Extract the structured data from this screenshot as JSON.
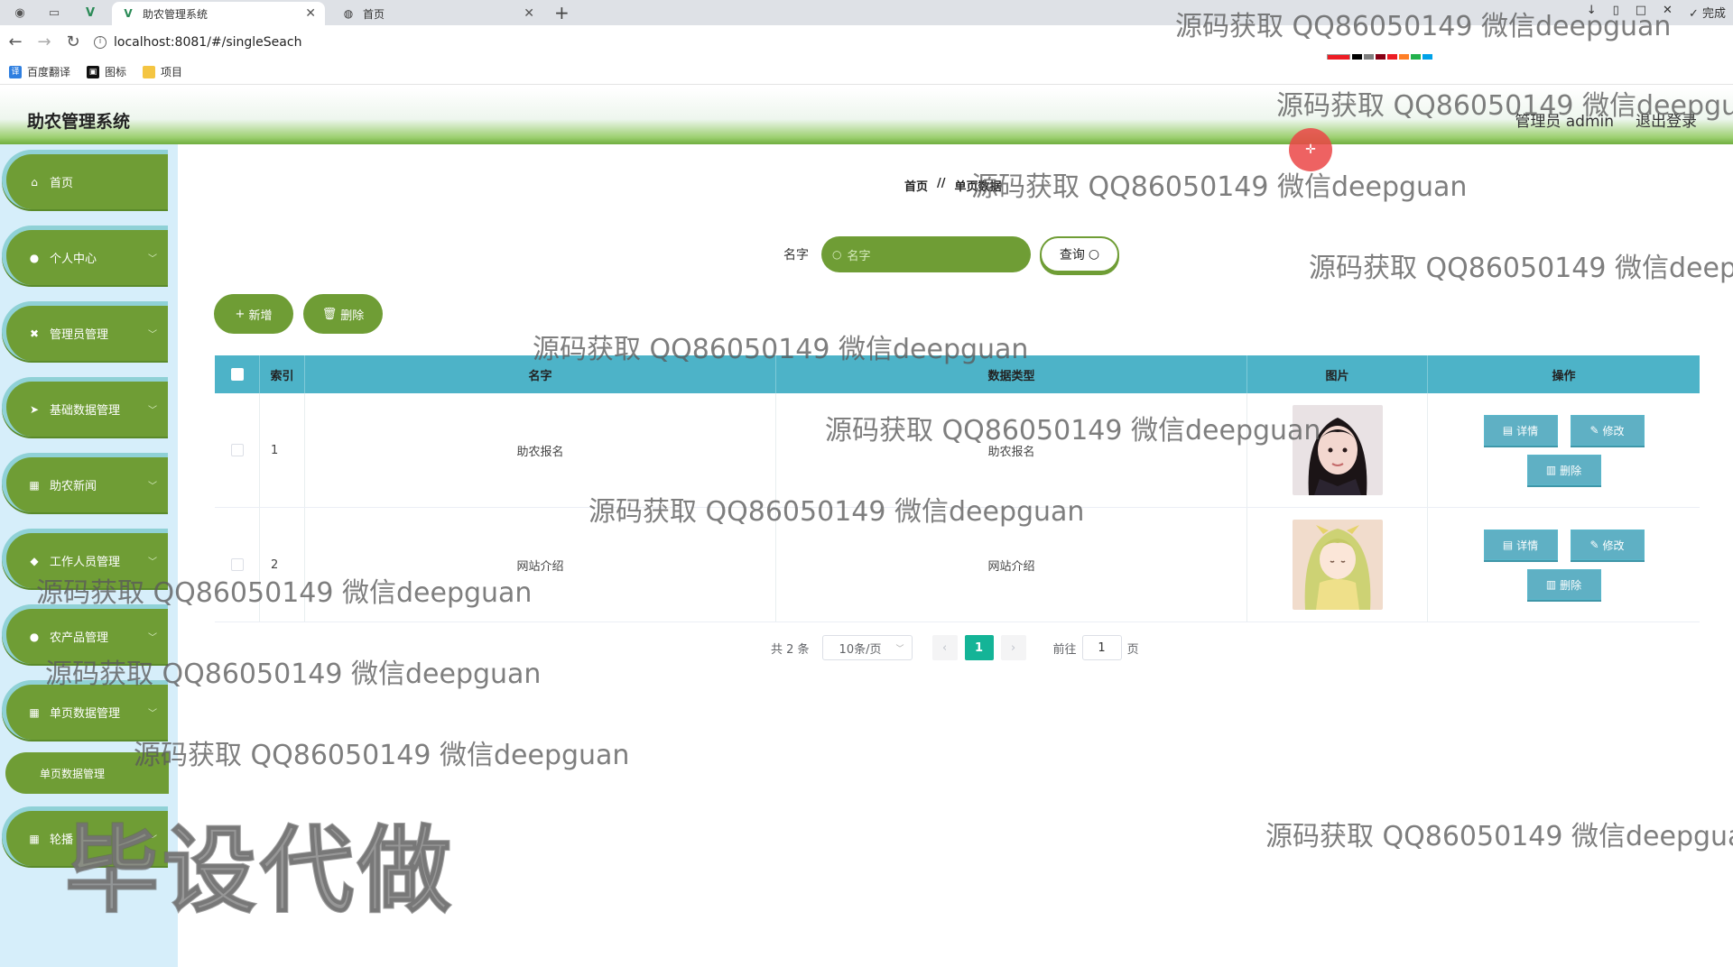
{
  "browser": {
    "tabs": [
      {
        "title": "助农管理系统",
        "active": true
      },
      {
        "title": "首页",
        "active": false
      }
    ],
    "url": "localhost:8081/#/singleSeach",
    "done_label": "完成",
    "bookmarks": [
      "百度翻译",
      "图标",
      "项目"
    ],
    "palette": [
      "#000000",
      "#7f7f7f",
      "#880015",
      "#ed1c24",
      "#ff7f27",
      "#22b14c",
      "#00a2e8",
      "#3f48cc",
      "#a349a4",
      "#ffffff",
      "#c3c3c3",
      "#b97a57",
      "#ffaec9",
      "#ffc90e",
      "#b5e61d",
      "#99d9ea",
      "#7092be",
      "#c8bfe7"
    ]
  },
  "header": {
    "title": "助农管理系统",
    "user_label": "管理员 admin",
    "logout_label": "退出登录"
  },
  "sidebar": {
    "items": [
      {
        "label": "首页",
        "icon": "home-icon",
        "has_arrow": false
      },
      {
        "label": "个人中心",
        "icon": "user-icon",
        "has_arrow": true
      },
      {
        "label": "管理员管理",
        "icon": "admin-icon",
        "has_arrow": true
      },
      {
        "label": "基础数据管理",
        "icon": "send-icon",
        "has_arrow": true
      },
      {
        "label": "助农新闻",
        "icon": "grid-icon",
        "has_arrow": true
      },
      {
        "label": "工作人员管理",
        "icon": "location-icon",
        "has_arrow": true
      },
      {
        "label": "农产品管理",
        "icon": "user-icon",
        "has_arrow": true
      },
      {
        "label": "单页数据管理",
        "icon": "grid-icon",
        "has_arrow": true
      },
      {
        "label": "轮播",
        "icon": "grid-icon",
        "has_arrow": true
      }
    ],
    "submenu_active": "单页数据管理"
  },
  "breadcrumb": {
    "home": "首页",
    "separator": "//",
    "current": "单页数据"
  },
  "search": {
    "label": "名字",
    "placeholder": "名字",
    "button_label": "查询"
  },
  "actions": {
    "add_label": "新增",
    "delete_label": "删除"
  },
  "table": {
    "columns": [
      "索引",
      "名字",
      "数据类型",
      "图片",
      "操作"
    ],
    "rows": [
      {
        "index": "1",
        "name": "助农报名",
        "type": "助农报名",
        "image": "photo-girl"
      },
      {
        "index": "2",
        "name": "网站介绍",
        "type": "网站介绍",
        "image": "illustration-girl"
      }
    ],
    "row_actions": {
      "detail": "详情",
      "edit": "修改",
      "delete": "删除"
    }
  },
  "pagination": {
    "total_label": "共 2 条",
    "page_size": "10条/页",
    "current_page": "1",
    "goto_label": "前往",
    "goto_value": "1",
    "page_suffix": "页"
  },
  "watermarks": [
    "源码获取 QQ86050149 微信deepguan",
    "源码获取 QQ86050149 微信deepgua",
    "源码获取 QQ86050149 微信deepguan",
    "源码获取 QQ86050149 微信deepg",
    "源码获取 QQ86050149 微信deepguan",
    "源码获取 QQ86050149 微信deepguan",
    "源码获取 QQ86050149 微信deepguan",
    "源码获取 QQ86050149 微信deepguan",
    "源码获取 QQ86050149 微信deepguan",
    "源码获取 QQ86050149 微信deepguan",
    "源码获取 QQ86050149 微信deepgua"
  ],
  "big_watermark": "毕设代做",
  "colors": {
    "accent_green": "#6f9d35",
    "table_header": "#4db3c8",
    "page_active": "#14b497",
    "sidebar_bg": "#d6eefa"
  }
}
